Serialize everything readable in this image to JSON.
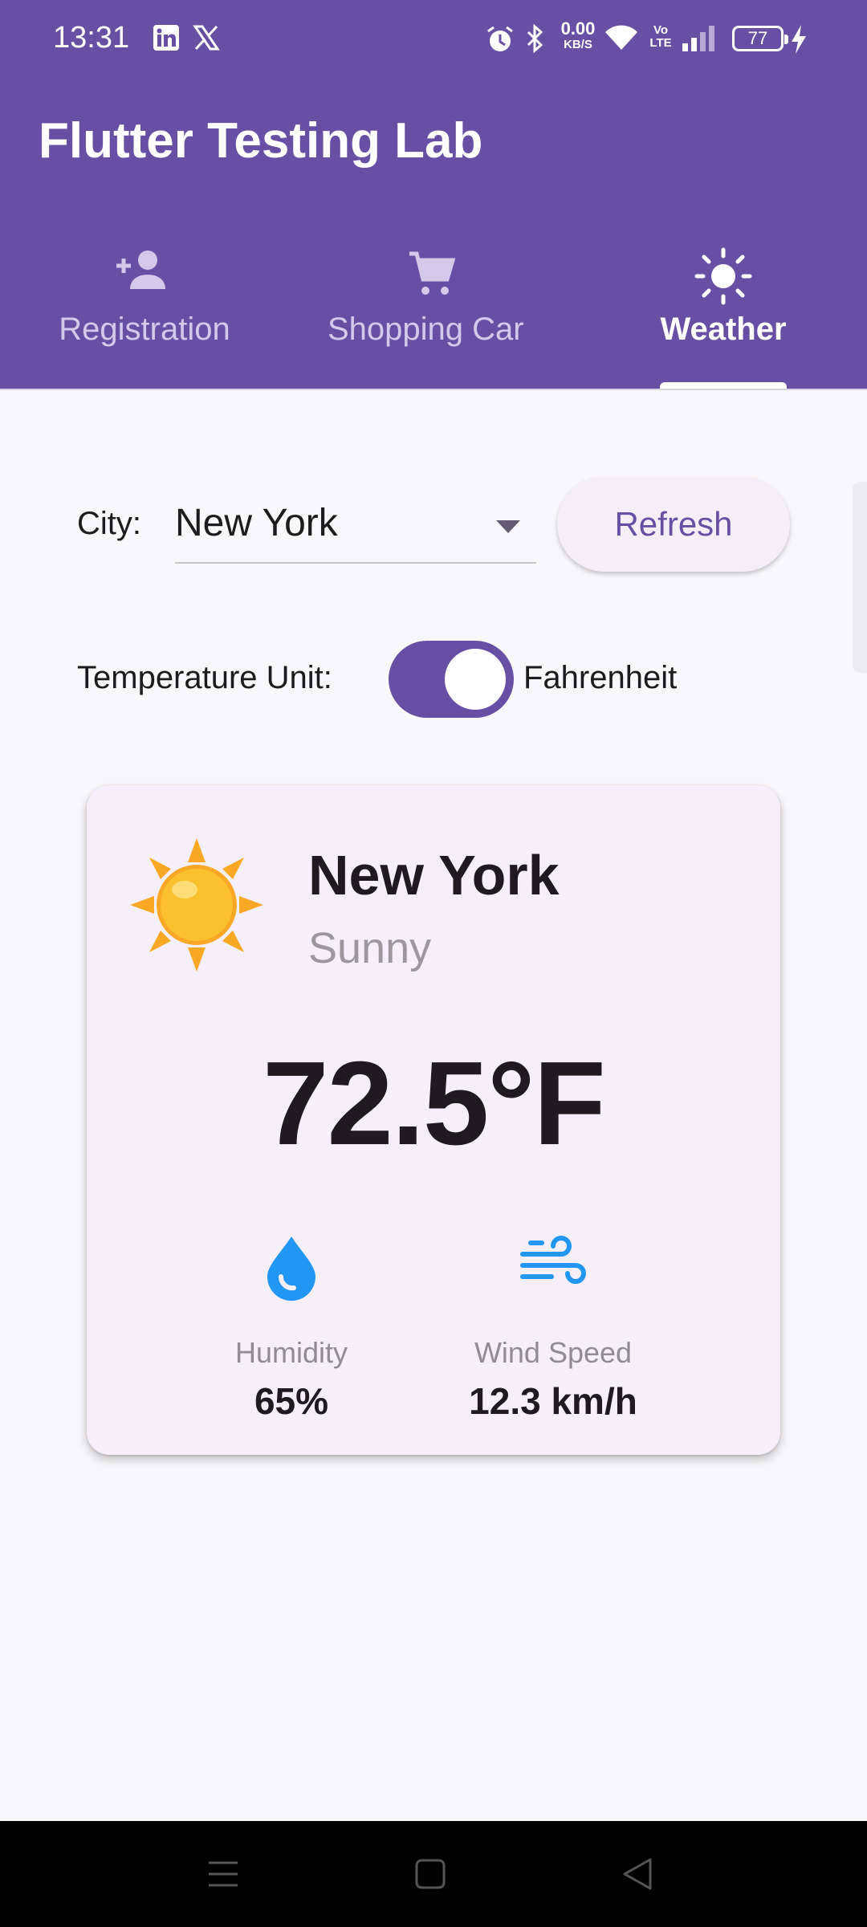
{
  "status_bar": {
    "time": "13:31",
    "net_speed": "0.00",
    "net_unit": "KB/S",
    "volte": "Vo LTE",
    "battery": "77",
    "icons": [
      "linkedin-icon",
      "x-icon",
      "alarm-icon",
      "bluetooth-icon",
      "wifi-icon",
      "signal-icon",
      "charging-icon"
    ]
  },
  "app_bar": {
    "title": "Flutter Testing Lab",
    "background": "#6750a4"
  },
  "tabs": [
    {
      "label": "Registration",
      "icon": "person-add-icon",
      "active": false
    },
    {
      "label": "Shopping Car",
      "icon": "shopping-cart-icon",
      "active": false
    },
    {
      "label": "Weather",
      "icon": "sun-icon",
      "active": true
    }
  ],
  "controls": {
    "city_label": "City:",
    "city_value": "New York",
    "refresh_label": "Refresh",
    "unit_label": "Temperature Unit:",
    "unit_toggle_on": true,
    "unit_value": "Fahrenheit"
  },
  "weather_card": {
    "city": "New York",
    "condition": "Sunny",
    "temperature": "72.5°F",
    "humidity_label": "Humidity",
    "humidity_value": "65%",
    "wind_label": "Wind Speed",
    "wind_value": "12.3 km/h",
    "accent_blue": "#2196f3",
    "sun_color": "#fbc02d"
  },
  "nav_bar": {
    "buttons": [
      "menu-icon",
      "home-icon",
      "back-icon"
    ]
  }
}
